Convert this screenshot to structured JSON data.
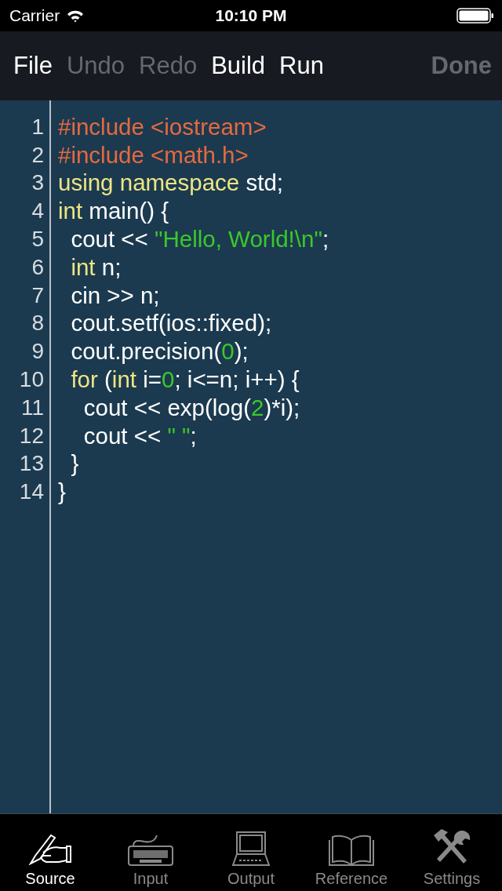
{
  "status_bar": {
    "carrier": "Carrier",
    "time": "10:10 PM"
  },
  "toolbar": {
    "items": [
      {
        "label": "File",
        "disabled": false
      },
      {
        "label": "Undo",
        "disabled": true
      },
      {
        "label": "Redo",
        "disabled": true
      },
      {
        "label": "Build",
        "disabled": false
      },
      {
        "label": "Run",
        "disabled": false
      }
    ],
    "done": {
      "label": "Done",
      "disabled": true
    }
  },
  "editor": {
    "lines": [
      {
        "number": "1",
        "tokens": [
          {
            "text": "#include <iostream>",
            "kind": "preproc"
          }
        ]
      },
      {
        "number": "2",
        "tokens": [
          {
            "text": "#include <math.h>",
            "kind": "preproc"
          }
        ]
      },
      {
        "number": "3",
        "tokens": [
          {
            "text": "using namespace",
            "kind": "keyword"
          },
          {
            "text": " std;",
            "kind": "plain"
          }
        ]
      },
      {
        "number": "4",
        "tokens": [
          {
            "text": "int",
            "kind": "keyword"
          },
          {
            "text": " main() {",
            "kind": "plain"
          }
        ]
      },
      {
        "number": "5",
        "tokens": [
          {
            "text": "  cout << ",
            "kind": "plain"
          },
          {
            "text": "\"Hello, World!\\n\"",
            "kind": "string"
          },
          {
            "text": ";",
            "kind": "plain"
          }
        ]
      },
      {
        "number": "6",
        "tokens": [
          {
            "text": "  int",
            "kind": "keyword"
          },
          {
            "text": " n;",
            "kind": "plain"
          }
        ]
      },
      {
        "number": "7",
        "tokens": [
          {
            "text": "  cin >> n;",
            "kind": "plain"
          }
        ]
      },
      {
        "number": "8",
        "tokens": [
          {
            "text": "  cout.setf(ios::fixed);",
            "kind": "plain"
          }
        ]
      },
      {
        "number": "9",
        "tokens": [
          {
            "text": "  cout.precision(",
            "kind": "plain"
          },
          {
            "text": "0",
            "kind": "number"
          },
          {
            "text": ");",
            "kind": "plain"
          }
        ]
      },
      {
        "number": "10",
        "tokens": [
          {
            "text": "  for",
            "kind": "keyword"
          },
          {
            "text": " (",
            "kind": "plain"
          },
          {
            "text": "int",
            "kind": "keyword"
          },
          {
            "text": " i=",
            "kind": "plain"
          },
          {
            "text": "0",
            "kind": "number"
          },
          {
            "text": "; i<=n; i++) {",
            "kind": "plain"
          }
        ]
      },
      {
        "number": "11",
        "tokens": [
          {
            "text": "    cout << exp(log(",
            "kind": "plain"
          },
          {
            "text": "2",
            "kind": "number"
          },
          {
            "text": ")*i);",
            "kind": "plain"
          }
        ]
      },
      {
        "number": "12",
        "tokens": [
          {
            "text": "    cout << ",
            "kind": "plain"
          },
          {
            "text": "\" \"",
            "kind": "string"
          },
          {
            "text": ";",
            "kind": "plain"
          }
        ]
      },
      {
        "number": "13",
        "tokens": [
          {
            "text": "  }",
            "kind": "plain"
          }
        ]
      },
      {
        "number": "14",
        "tokens": [
          {
            "text": "}",
            "kind": "plain"
          }
        ]
      }
    ]
  },
  "tab_bar": {
    "tabs": [
      {
        "label": "Source",
        "selected": true,
        "kind": "pen"
      },
      {
        "label": "Input",
        "selected": false,
        "kind": "keyboard"
      },
      {
        "label": "Output",
        "selected": false,
        "kind": "computer"
      },
      {
        "label": "Reference",
        "selected": false,
        "kind": "book"
      },
      {
        "label": "Settings",
        "selected": false,
        "kind": "tools"
      }
    ]
  }
}
